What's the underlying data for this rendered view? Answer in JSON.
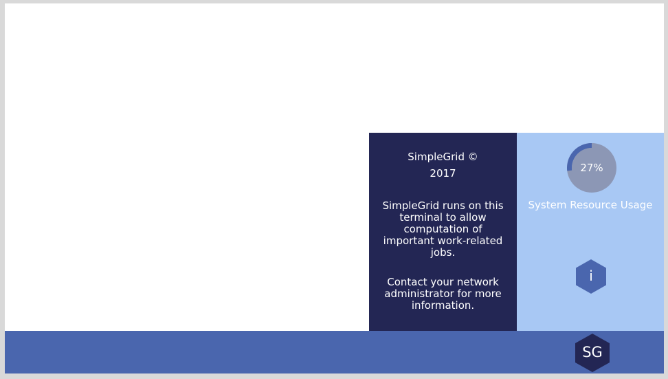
{
  "info_panel": {
    "title_line1": "SimpleGrid ©",
    "title_line2": "2017",
    "body1": "SimpleGrid runs on this terminal to allow computation of important work-related jobs.",
    "body2": "Contact your network administrator for more information."
  },
  "usage_panel": {
    "percent_text": "27%",
    "percent_value": 27,
    "label": "System Resource Usage",
    "info_button_glyph": "i",
    "info_icon": "info-icon"
  },
  "taskbar": {
    "logo_text": "SG"
  },
  "colors": {
    "info_panel_bg": "#232654",
    "usage_panel_bg": "#a8c8f4",
    "taskbar_bg": "#4a66ae",
    "gauge_track": "#8c97b5",
    "gauge_fill": "#4a66ae",
    "hex_fill": "#4a66ae",
    "logo_hex_fill": "#232654"
  }
}
